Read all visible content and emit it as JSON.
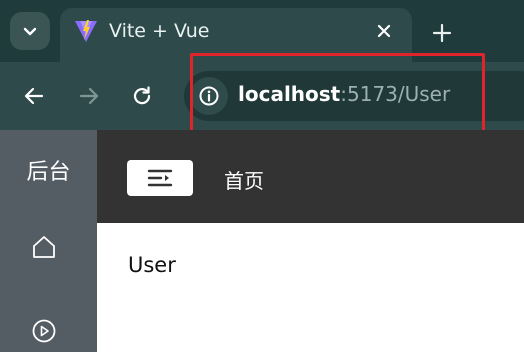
{
  "browser": {
    "tab": {
      "title": "Vite + Vue"
    },
    "address_bar": {
      "host": "localhost",
      "rest": ":5173/User"
    },
    "icons": {
      "tab_list": "chevron-down-icon",
      "favicon": "vite-logo-icon",
      "close": "close-icon",
      "new_tab": "plus-icon",
      "back": "arrow-left-icon",
      "forward": "arrow-right-icon",
      "reload": "reload-icon",
      "site_info": "info-icon"
    },
    "highlight_color": "#e0242c"
  },
  "sidebar": {
    "title": "后台",
    "items": [
      {
        "icon": "home-icon"
      },
      {
        "icon": "play-circle-icon"
      }
    ]
  },
  "header": {
    "breadcrumb": "首页",
    "toggle_icon": "menu-fold-icon"
  },
  "main": {
    "text": "User"
  },
  "colors": {
    "tabstrip": "#1f3b3b",
    "toolbar": "#2f4a4a",
    "sidebar": "#545c64",
    "header": "#333333"
  }
}
